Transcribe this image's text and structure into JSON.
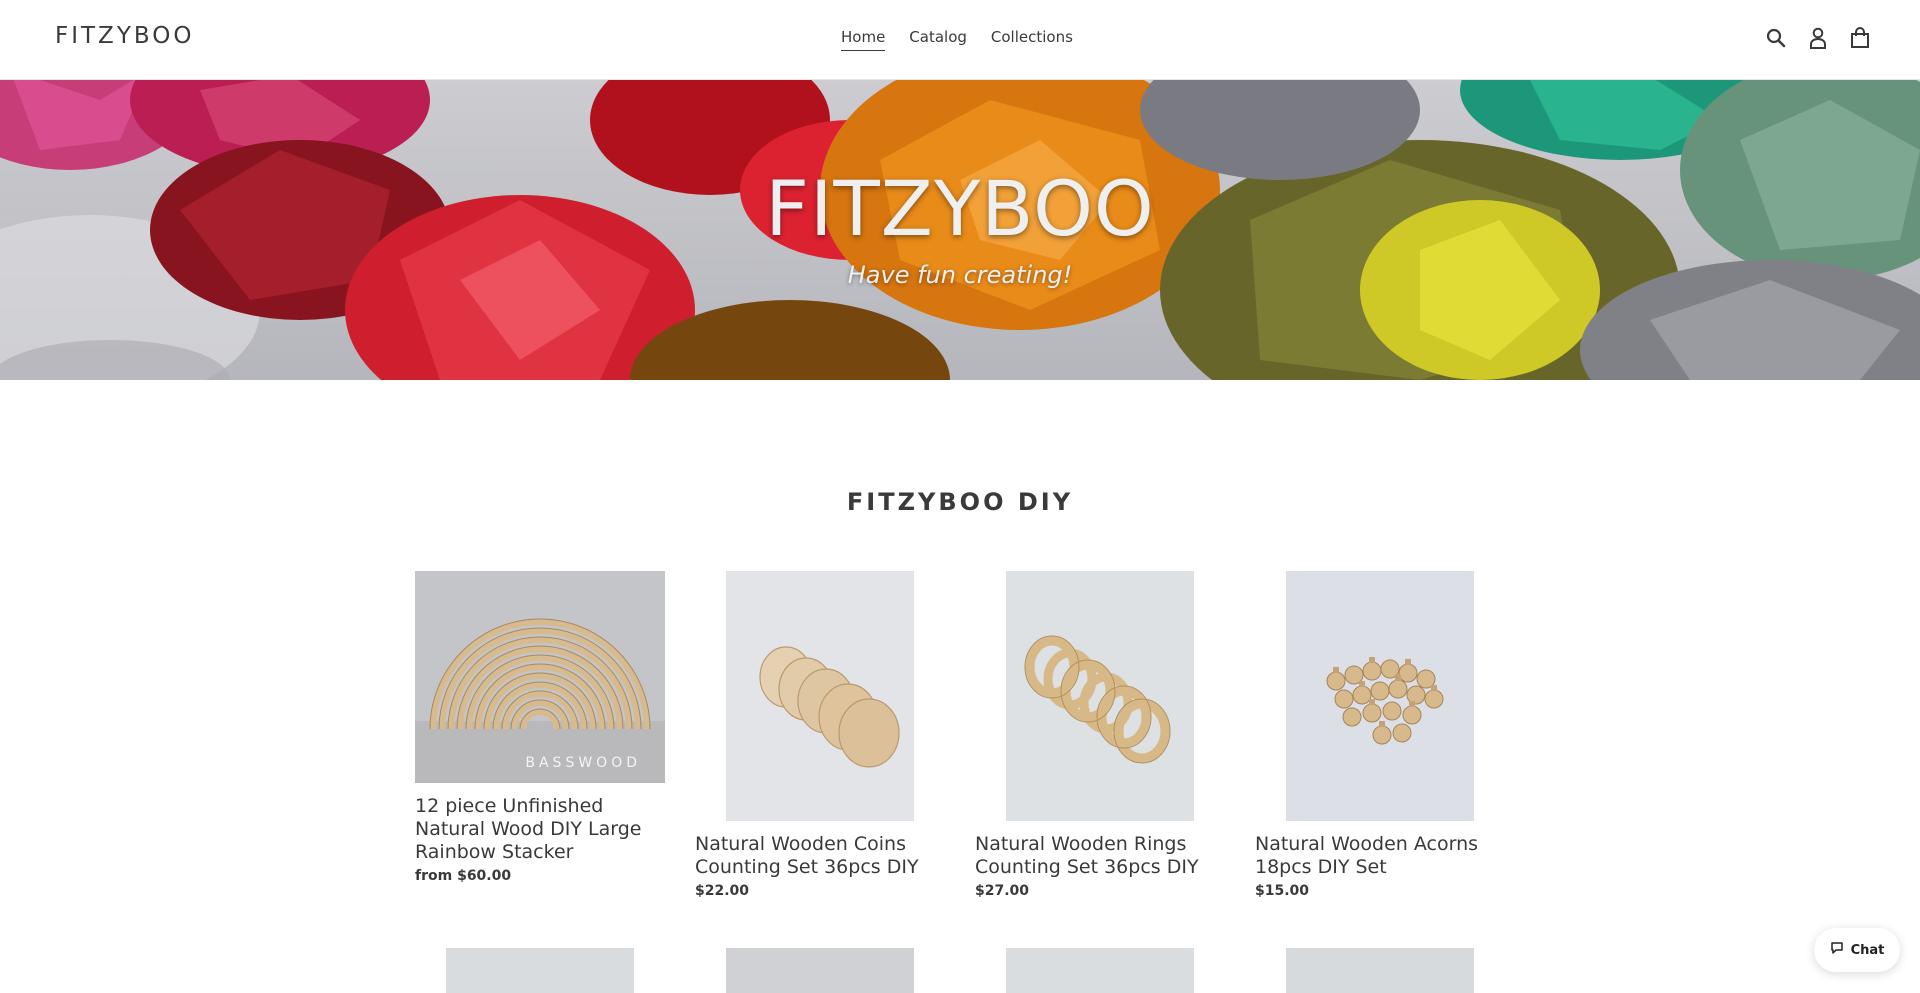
{
  "header": {
    "logo": "FITZYBOO",
    "nav": [
      "Home",
      "Catalog",
      "Collections"
    ],
    "icons": [
      "search-icon",
      "account-icon",
      "cart-icon"
    ]
  },
  "hero": {
    "title": "FITZYBOO",
    "subtitle": "Have fun creating!"
  },
  "collection": {
    "title": "FITZYBOO DIY",
    "products": [
      {
        "name": "12 piece Unfinished Natural Wood DIY Large Rainbow Stacker",
        "price": "from $60.00",
        "image_caption": "BASSWOOD"
      },
      {
        "name": "Natural Wooden Coins Counting Set 36pcs DIY",
        "price": "$22.00"
      },
      {
        "name": "Natural Wooden Rings Counting Set 36pcs DIY",
        "price": "$27.00"
      },
      {
        "name": "Natural Wooden Acorns 18pcs DIY Set",
        "price": "$15.00"
      }
    ]
  },
  "chat": {
    "label": "Chat"
  },
  "colors": {
    "text": "#3a3a3a",
    "wood": "#d9bf97",
    "background": "#ffffff"
  }
}
